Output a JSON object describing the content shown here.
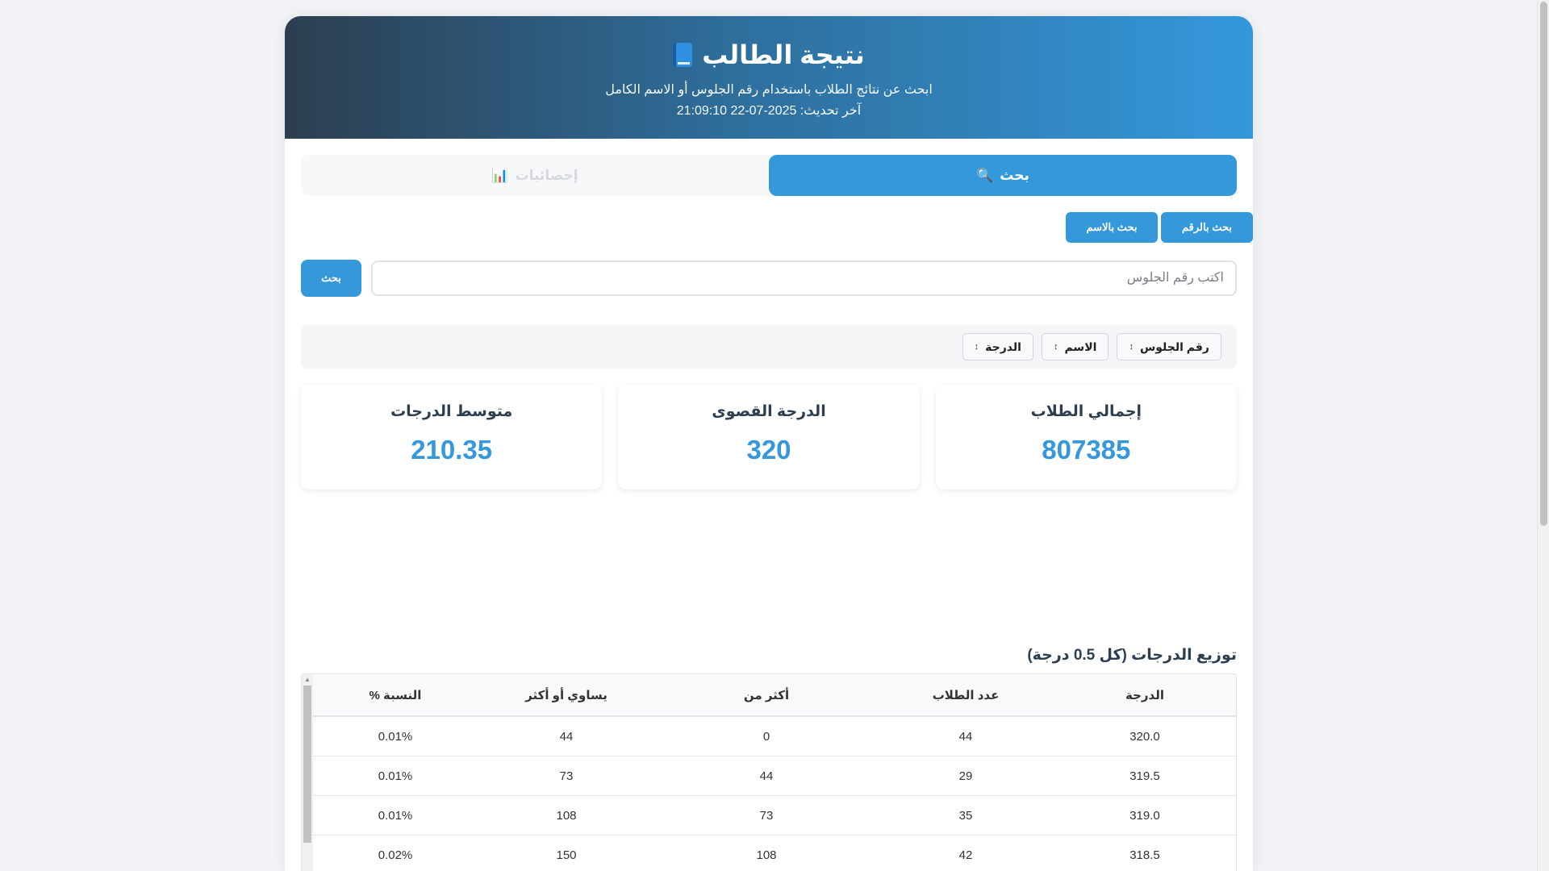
{
  "header": {
    "title": "نتيجة الطالب",
    "icon": "book-icon",
    "subtitle": "ابحث عن نتائج الطلاب باستخدام رقم الجلوس أو الاسم الكامل",
    "updated": "آخر تحديث: 2025-07-22 21:09:10"
  },
  "tabs": [
    {
      "label": "بحث",
      "icon": "🔍",
      "active": true
    },
    {
      "label": "إحصائيات",
      "icon": "📊",
      "active": false
    }
  ],
  "search_modes": {
    "by_number": "بحث بالرقم",
    "by_name": "بحث بالاسم"
  },
  "search": {
    "placeholder": "اكتب رقم الجلوس",
    "value": "",
    "button": "بحث"
  },
  "sort": {
    "icon": "↕",
    "fields": [
      "رقم الجلوس",
      "الاسم",
      "الدرجة"
    ]
  },
  "stats": [
    {
      "label": "إجمالي الطلاب",
      "value": "807385"
    },
    {
      "label": "الدرجة القصوى",
      "value": "320"
    },
    {
      "label": "متوسط الدرجات",
      "value": "210.35"
    }
  ],
  "distribution": {
    "title": "توزيع الدرجات (كل 0.5 درجة)",
    "columns": [
      "الدرجة",
      "عدد الطلاب",
      "أكثر من",
      "يساوي أو أكثر",
      "النسبة %"
    ],
    "rows": [
      [
        "320.0",
        "44",
        "0",
        "44",
        "0.01%"
      ],
      [
        "319.5",
        "29",
        "44",
        "73",
        "0.01%"
      ],
      [
        "319.0",
        "35",
        "73",
        "108",
        "0.01%"
      ],
      [
        "318.5",
        "42",
        "108",
        "150",
        "0.02%"
      ]
    ]
  },
  "colors": {
    "accent": "#3498db",
    "header_dark": "#2c3e50"
  }
}
